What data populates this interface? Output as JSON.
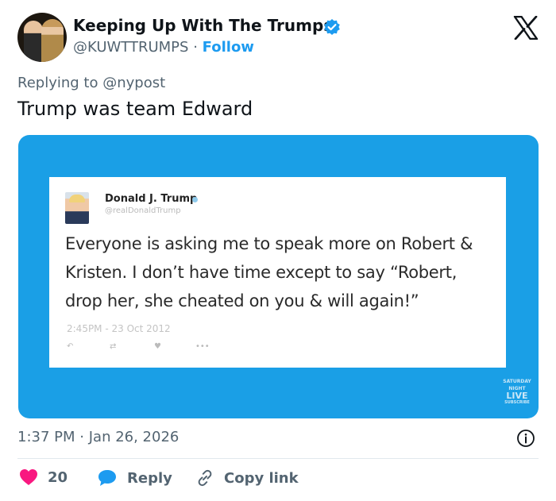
{
  "author": {
    "name": "Keeping Up With The Trumps",
    "handle": "@KUWTTRUMPS",
    "separator": "·",
    "follow_label": "Follow"
  },
  "reply_context": {
    "prefix": "Replying to",
    "mention": "@nypost"
  },
  "post": {
    "text": "Trump was team Edward"
  },
  "media": {
    "embedded_tweet": {
      "name": "Donald J. Trump",
      "handle": "@realDonaldTrump",
      "text": "Everyone is asking me to speak more on Robert & Kristen. I don’t have time except to say “Robert, drop her, she cheated on you & will again!”",
      "time": "2:45PM - 23 Oct 2012",
      "actions": [
        "↶",
        "⇄",
        "♥",
        "•••"
      ]
    },
    "watermark": {
      "line1": "SATURDAY NIGHT",
      "line2": "LIVE",
      "line3": "SUBSCRIBE"
    }
  },
  "meta": {
    "time": "1:37 PM",
    "separator": "·",
    "date": "Jan 26, 2026"
  },
  "actions": {
    "like_count": "20",
    "reply_label": "Reply",
    "copy_link_label": "Copy link"
  },
  "colors": {
    "accent": "#1d9bf0",
    "like": "#f91880",
    "media_bg": "#1a9fe6",
    "secondary_text": "#536471"
  },
  "icons": {
    "verified": "verified-badge-icon",
    "x_logo": "x-logo-icon",
    "info": "info-icon",
    "like": "heart-icon",
    "reply": "speech-bubble-icon",
    "copy_link": "link-icon"
  }
}
